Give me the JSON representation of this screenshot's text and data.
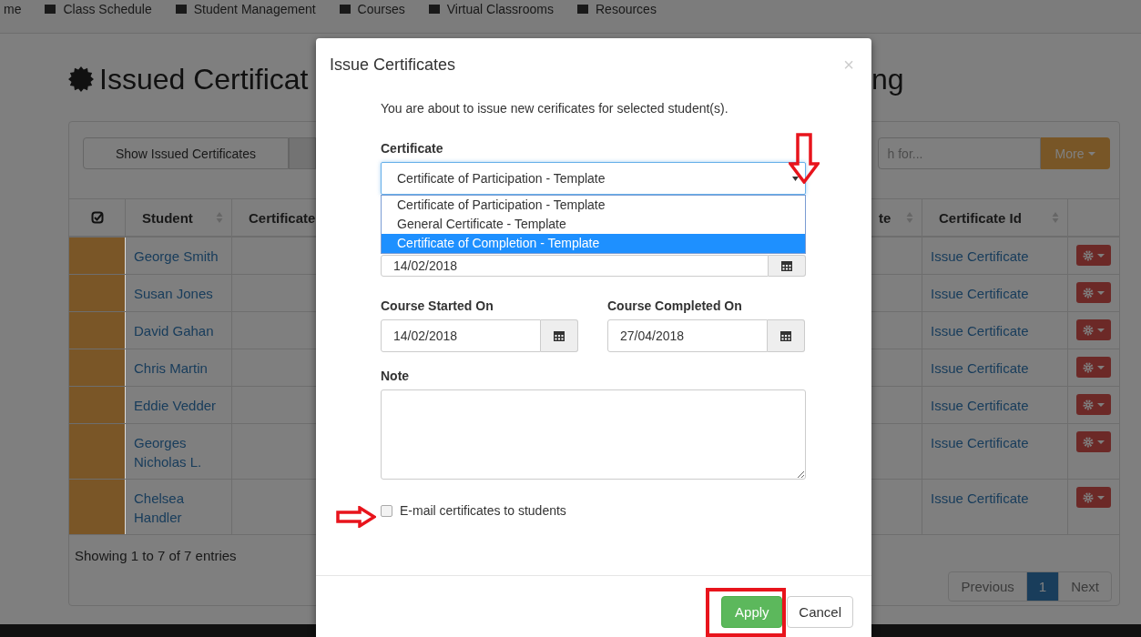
{
  "navbar": {
    "items": [
      {
        "label": "me"
      },
      {
        "label": "Class Schedule"
      },
      {
        "label": "Student Management"
      },
      {
        "label": "Courses"
      },
      {
        "label": "Virtual Classrooms"
      },
      {
        "label": "Resources"
      }
    ]
  },
  "heading_left": "Issued Certificat",
  "heading_right": "ng",
  "toolbar": {
    "show_button": "Show Issued Certificates",
    "search_placeholder": "h for...",
    "more_button": "More"
  },
  "table": {
    "columns_left": [
      "Student",
      "Certificate"
    ],
    "columns_right": [
      "te",
      "Certificate Id"
    ],
    "rows": [
      {
        "student": "George Smith",
        "color": "#7a5627",
        "action": "Issue Certificate"
      },
      {
        "student": "Susan Jones",
        "color": "#7a5627",
        "action": "Issue Certificate"
      },
      {
        "student": "David Gahan",
        "color": "#7a5627",
        "action": "Issue Certificate"
      },
      {
        "student": "Chris Martin",
        "color": "#7a5627",
        "action": "Issue Certificate"
      },
      {
        "student": "Eddie Vedder",
        "color": "#7a5627",
        "action": "Issue Certificate"
      },
      {
        "student": "Georges Nicholas L.",
        "color": "#7a5627",
        "action": "Issue Certificate"
      },
      {
        "student": "Chelsea Handler",
        "color": "#7a5627",
        "action": "Issue Certificate"
      }
    ]
  },
  "footer": {
    "info": "Showing 1 to 7 of 7 entries",
    "pagination": [
      {
        "label": "Previous",
        "selected": false
      },
      {
        "label": "1",
        "selected": true
      },
      {
        "label": "Next",
        "selected": false
      }
    ]
  },
  "modal": {
    "title": "Issue Certificates",
    "close": "×",
    "intro": "You are about to issue new cerificates for selected student(s).",
    "certificate": {
      "label": "Certificate",
      "value": "Certificate of Participation - Template",
      "options": [
        {
          "label": "Certificate of Participation - Template",
          "highlighted": false
        },
        {
          "label": "General Certificate - Template",
          "highlighted": false
        },
        {
          "label": "Certificate of Completion - Template",
          "highlighted": true
        }
      ]
    },
    "hidden_date": "14/02/2018",
    "started": {
      "label": "Course Started On",
      "value": "14/02/2018"
    },
    "completed": {
      "label": "Course Completed On",
      "value": "27/04/2018"
    },
    "note": {
      "label": "Note"
    },
    "email": {
      "label": "E-mail certificates to students",
      "checked": false
    },
    "buttons": [
      {
        "label": "Apply",
        "kind": "primary"
      },
      {
        "label": "Cancel",
        "kind": "default"
      }
    ]
  }
}
